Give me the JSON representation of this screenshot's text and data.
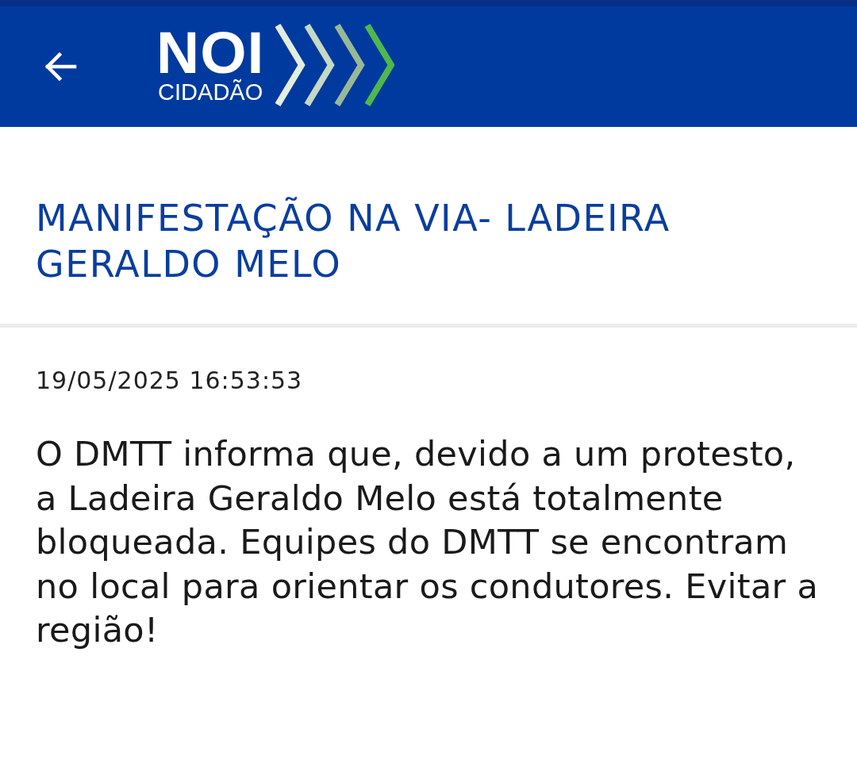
{
  "header": {
    "logo": {
      "title": "NOI",
      "subtitle": "CIDADÃO"
    }
  },
  "article": {
    "title": "MANIFESTAÇÃO NA VIA- LADEIRA GERALDO MELO",
    "timestamp": "19/05/2025 16:53:53",
    "body": "O DMTT informa que, devido a um protesto, a Ladeira Geraldo Melo está totalmente bloqueada. Equipes do DMTT se encontram no local para orientar os condutores. Evitar a região!"
  }
}
